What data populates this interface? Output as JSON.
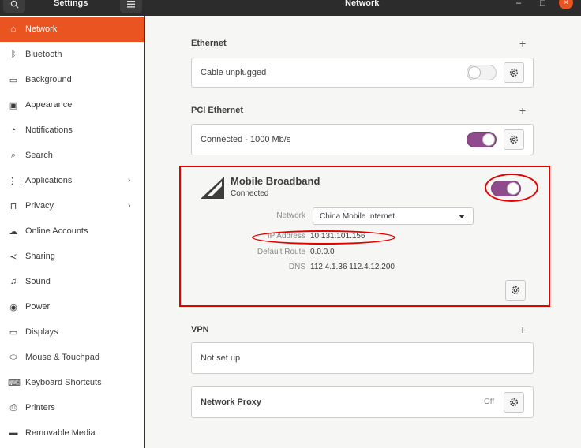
{
  "titlebar": {
    "app_title": "Settings",
    "page_title": "Network",
    "search_icon": "search-icon",
    "menu_icon": "hamburger-menu-icon",
    "minimize": "–",
    "maximize": "□",
    "close": "×"
  },
  "sidebar": {
    "items": [
      {
        "label": "Network",
        "icon": "⌂"
      },
      {
        "label": "Bluetooth",
        "icon": "ᛒ"
      },
      {
        "label": "Background",
        "icon": "▭"
      },
      {
        "label": "Appearance",
        "icon": "▣"
      },
      {
        "label": "Notifications",
        "icon": "◔"
      },
      {
        "label": "Search",
        "icon": "⌕"
      },
      {
        "label": "Applications",
        "icon": "⋮⋮"
      },
      {
        "label": "Privacy",
        "icon": "⊓"
      },
      {
        "label": "Online Accounts",
        "icon": "☁"
      },
      {
        "label": "Sharing",
        "icon": "≺"
      },
      {
        "label": "Sound",
        "icon": "♫"
      },
      {
        "label": "Power",
        "icon": "◉"
      },
      {
        "label": "Displays",
        "icon": "▭"
      },
      {
        "label": "Mouse & Touchpad",
        "icon": "⬭"
      },
      {
        "label": "Keyboard Shortcuts",
        "icon": "⌨"
      },
      {
        "label": "Printers",
        "icon": "⎙"
      },
      {
        "label": "Removable Media",
        "icon": "▬"
      }
    ],
    "arrow": "›"
  },
  "ethernet": {
    "title": "Ethernet",
    "add": "+",
    "status": "Cable unplugged",
    "enabled": false
  },
  "pci_ethernet": {
    "title": "PCI Ethernet",
    "add": "+",
    "status": "Connected - 1000 Mb/s",
    "enabled": true
  },
  "mobile_broadband": {
    "title": "Mobile Broadband",
    "status": "Connected",
    "enabled": true,
    "network_label": "Network",
    "network_value": "China Mobile Internet",
    "ip_label": "IP Address",
    "ip_value": "10.131.101.156",
    "route_label": "Default Route",
    "route_value": "0.0.0.0",
    "dns_label": "DNS",
    "dns_value": "112.4.1.36 112.4.12.200"
  },
  "vpn": {
    "title": "VPN",
    "add": "+",
    "status": "Not set up"
  },
  "proxy": {
    "title": "Network Proxy",
    "status": "Off"
  },
  "colors": {
    "accent": "#e95420",
    "toggle_on": "#8f4b8b",
    "annotation": "#e60000"
  }
}
